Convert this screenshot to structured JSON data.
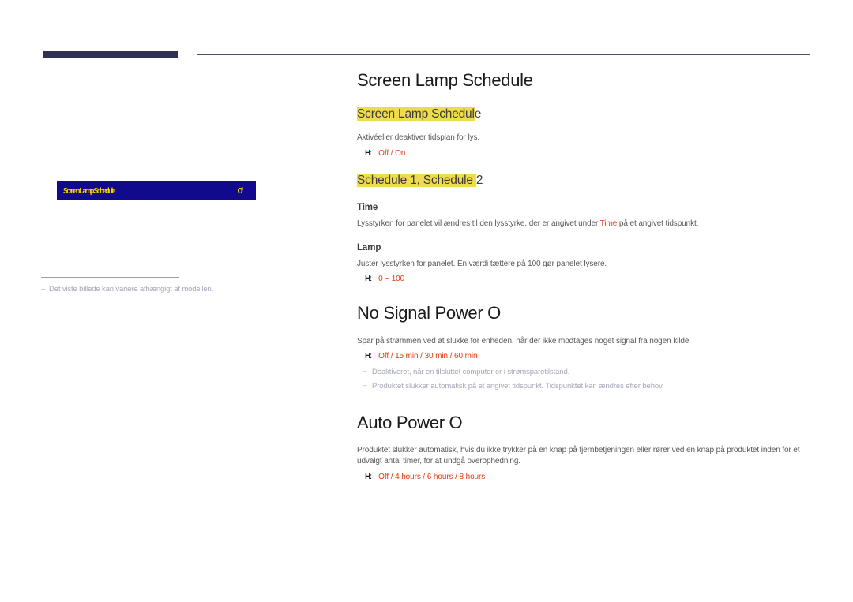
{
  "page": {
    "language": "da",
    "colors": {
      "navy_tab": "#2e3356",
      "osd_background": "#110a8c",
      "osd_text": "#ffd400",
      "highlight": "#efdc4e",
      "accent_red": "#e8380d",
      "body_gray": "#58585b",
      "note_gray": "#a5a7b5"
    }
  },
  "illustration": {
    "osd_menu": {
      "label": "Screen Lamp Schedule",
      "value": "Off"
    },
    "footnote": {
      "dash": "–",
      "text": "Det viste billede kan variere afhængigt af modellen."
    }
  },
  "main_title": "Screen Lamp Schedule",
  "sections": [
    {
      "id": "screen-lamp-schedule",
      "heading_highlighted": "Screen Lamp Schedul",
      "heading_tail": "e",
      "description": "Aktivéeller deaktiver tidsplan for lys.",
      "options": {
        "marker": "Ht",
        "values": [
          "Off",
          "On"
        ],
        "separator": " / "
      }
    },
    {
      "id": "schedule-1-2",
      "heading_highlighted": "Schedule 1, Schedule ",
      "heading_tail": "2",
      "subsections": [
        {
          "id": "time",
          "title": "Time",
          "description_before": "Lysstyrken for panelet vil ændres til den lysstyrke, der er angivet under ",
          "description_accent": "Time",
          "description_after": " på et angivet tidspunkt."
        },
        {
          "id": "lamp",
          "title": "Lamp",
          "description": "Juster lysstyrken for panelet. En værdi tættere på 100 gør panelet lysere.",
          "options": {
            "marker": "Ht",
            "values": [
              "0 ~ 100"
            ],
            "separator": " / "
          }
        }
      ]
    }
  ],
  "no_signal_power_off": {
    "title": "No Signal Power O",
    "description": "Spar på strømmen ved at slukke for enheden, når der ikke modtages noget signal fra nogen kilde.",
    "options": {
      "marker": "Ht",
      "values": [
        "Off",
        "15 min",
        "30 min",
        "60 min"
      ],
      "separator": " / "
    },
    "notes": [
      "Deaktiveret, når en tilsluttet computer er i strømsparetilstand.",
      "Produktet slukker automatisk på et angivet tidspunkt. Tidspunktet kan ændres efter behov."
    ],
    "note_dash": "–"
  },
  "auto_power_off": {
    "title": "Auto Power O",
    "description": "Produktet slukker automatisk, hvis du ikke trykker på en knap på fjernbetjeningen eller rører ved en knap på produktet inden for et udvalgt antal timer, for at undgå overophedning.",
    "options": {
      "marker": "Ht",
      "values": [
        "Off",
        "4 hours",
        "6 hours",
        "8 hours"
      ],
      "separator": " / "
    }
  }
}
